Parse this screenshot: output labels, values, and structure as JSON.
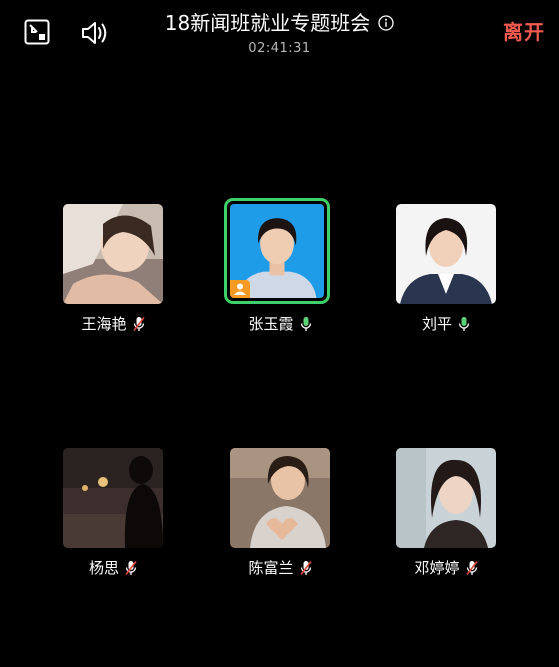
{
  "header": {
    "title": "18新闻班就业专题班会",
    "timer": "02:41:31",
    "leave_label": "离开"
  },
  "icons": {
    "minimize": "minimize-window-icon",
    "speaker": "speaker-icon",
    "info": "info-icon",
    "mic_on": "microphone-icon",
    "mic_off": "microphone-muted-icon",
    "host": "host-badge-icon"
  },
  "colors": {
    "background": "#000000",
    "leave": "#f25b4f",
    "speaking_border": "#3ed06b",
    "mic_on": "#5cd278",
    "mic_off_slash": "#e0483e",
    "host_badge": "#f59a23"
  },
  "participants": [
    {
      "name": "王海艳",
      "mic": "muted",
      "speaking": false
    },
    {
      "name": "张玉霞",
      "mic": "on",
      "speaking": true,
      "host": true
    },
    {
      "name": "刘平",
      "mic": "on",
      "speaking": false
    },
    {
      "name": "杨思",
      "mic": "muted",
      "speaking": false
    },
    {
      "name": "陈富兰",
      "mic": "muted",
      "speaking": false
    },
    {
      "name": "邓婷婷",
      "mic": "muted",
      "speaking": false
    }
  ]
}
